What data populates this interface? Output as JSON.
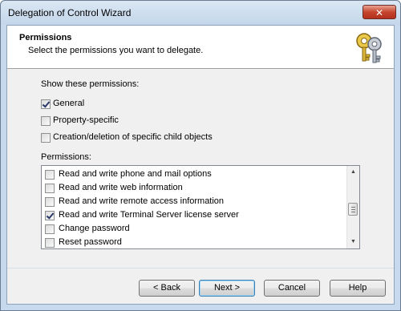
{
  "window": {
    "title": "Delegation of Control Wizard",
    "close_glyph": "✕"
  },
  "header": {
    "title": "Permissions",
    "subtitle": "Select the permissions you want to delegate.",
    "icon": "keys-icon"
  },
  "show_permissions": {
    "label": "Show these permissions:",
    "options": [
      {
        "label": "General",
        "checked": true
      },
      {
        "label": "Property-specific",
        "checked": false
      },
      {
        "label": "Creation/deletion of specific child objects",
        "checked": false
      }
    ]
  },
  "permissions": {
    "label": "Permissions:",
    "items": [
      {
        "label": "Read and write phone and mail options",
        "checked": false
      },
      {
        "label": "Read and write web information",
        "checked": false
      },
      {
        "label": "Read and write remote access information",
        "checked": false
      },
      {
        "label": "Read and write Terminal Server license server",
        "checked": true
      },
      {
        "label": "Change password",
        "checked": false
      },
      {
        "label": "Reset password",
        "checked": false
      }
    ]
  },
  "buttons": {
    "back": "< Back",
    "next": "Next >",
    "cancel": "Cancel",
    "help": "Help"
  },
  "colors": {
    "title_bar": "#c3d6ea",
    "close_button": "#c5452f",
    "dialog_bg": "#f0f0f0",
    "default_button_border": "#3c7fb1"
  }
}
